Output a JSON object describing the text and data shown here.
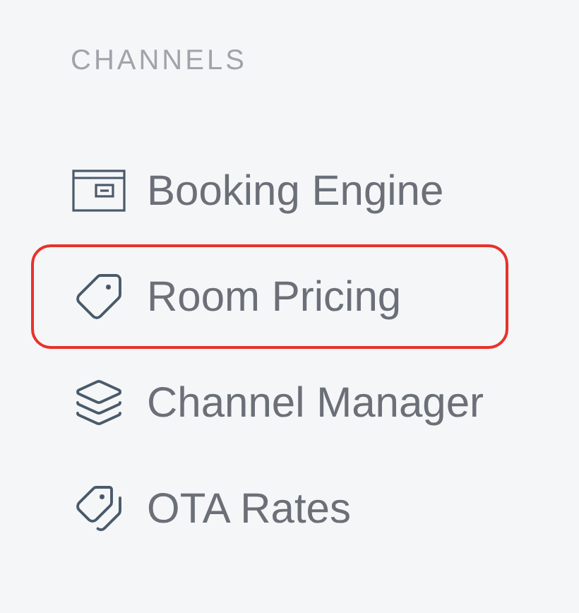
{
  "section_title": "CHANNELS",
  "items": [
    {
      "label": "Booking Engine",
      "highlighted": false
    },
    {
      "label": "Room Pricing",
      "highlighted": true
    },
    {
      "label": "Channel Manager",
      "highlighted": false
    },
    {
      "label": "OTA Rates",
      "highlighted": false
    }
  ]
}
